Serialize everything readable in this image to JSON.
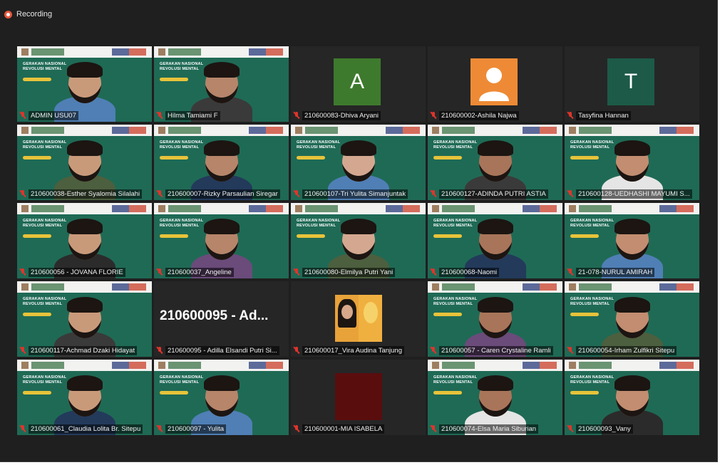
{
  "recording": {
    "label": "Recording"
  },
  "slide": {
    "line1": "GERAKAN NASIONAL",
    "line2": "REVOLUSI MENTAL"
  },
  "colors": {
    "active_border": "#d4e15a",
    "mic_muted": "#e0342c",
    "slide_bg": "#1f6a55"
  },
  "participants": [
    {
      "name": "ADMIN USU07",
      "kind": "video",
      "active": true
    },
    {
      "name": "Hilma Tamiami F",
      "kind": "video"
    },
    {
      "name": "210600083-Dhiva Aryani",
      "kind": "letter",
      "letter": "A",
      "color": "#3e7a2d"
    },
    {
      "name": "210600002-Ashila Najwa",
      "kind": "person-icon",
      "color": "#ee8a35"
    },
    {
      "name": "Tasyfina Hannan",
      "kind": "letter",
      "letter": "T",
      "color": "#1d5a48"
    },
    {
      "name": "210600038-Esther Syalomia Silalahi",
      "kind": "video"
    },
    {
      "name": "210600007-Rizky Parsaulian Siregar",
      "kind": "video"
    },
    {
      "name": "210600107-Tri Yulita Simanjuntak",
      "kind": "video"
    },
    {
      "name": "210600127-ADINDA PUTRI ASTIA",
      "kind": "video"
    },
    {
      "name": "210600128-UEDHASHI MAYUMI S...",
      "kind": "video"
    },
    {
      "name": "210600056 - JOVANA FLORIE",
      "kind": "video"
    },
    {
      "name": "210600037_Angeline",
      "kind": "video"
    },
    {
      "name": "210600080-Elmilya Putri Yani",
      "kind": "video"
    },
    {
      "name": "210600068-Naomi",
      "kind": "video"
    },
    {
      "name": "21-078-NURUL AMIRAH",
      "kind": "video"
    },
    {
      "name": "210600117-Achmad Dzaki Hidayat",
      "kind": "video"
    },
    {
      "name": "210600095 - Adilla Elsandi Putri Si...",
      "kind": "name-text",
      "big": "210600095 - Ad..."
    },
    {
      "name": "210600017_Vira Audina Tanjung",
      "kind": "small-video"
    },
    {
      "name": "210600057 - Caren Crystaline Ramli",
      "kind": "video"
    },
    {
      "name": "210600054-Irham Zulfikri Sitepu",
      "kind": "video"
    },
    {
      "name": "210600061_Claudia Lolita Br. Sitepu",
      "kind": "video"
    },
    {
      "name": "210600097 - Yulita",
      "kind": "video"
    },
    {
      "name": "210600001-MIA ISABELA",
      "kind": "dark-box",
      "color": "#5a0d0d"
    },
    {
      "name": "210600074-Elsa Maria Siburian",
      "kind": "video"
    },
    {
      "name": "210600093_Vany",
      "kind": "video"
    }
  ]
}
